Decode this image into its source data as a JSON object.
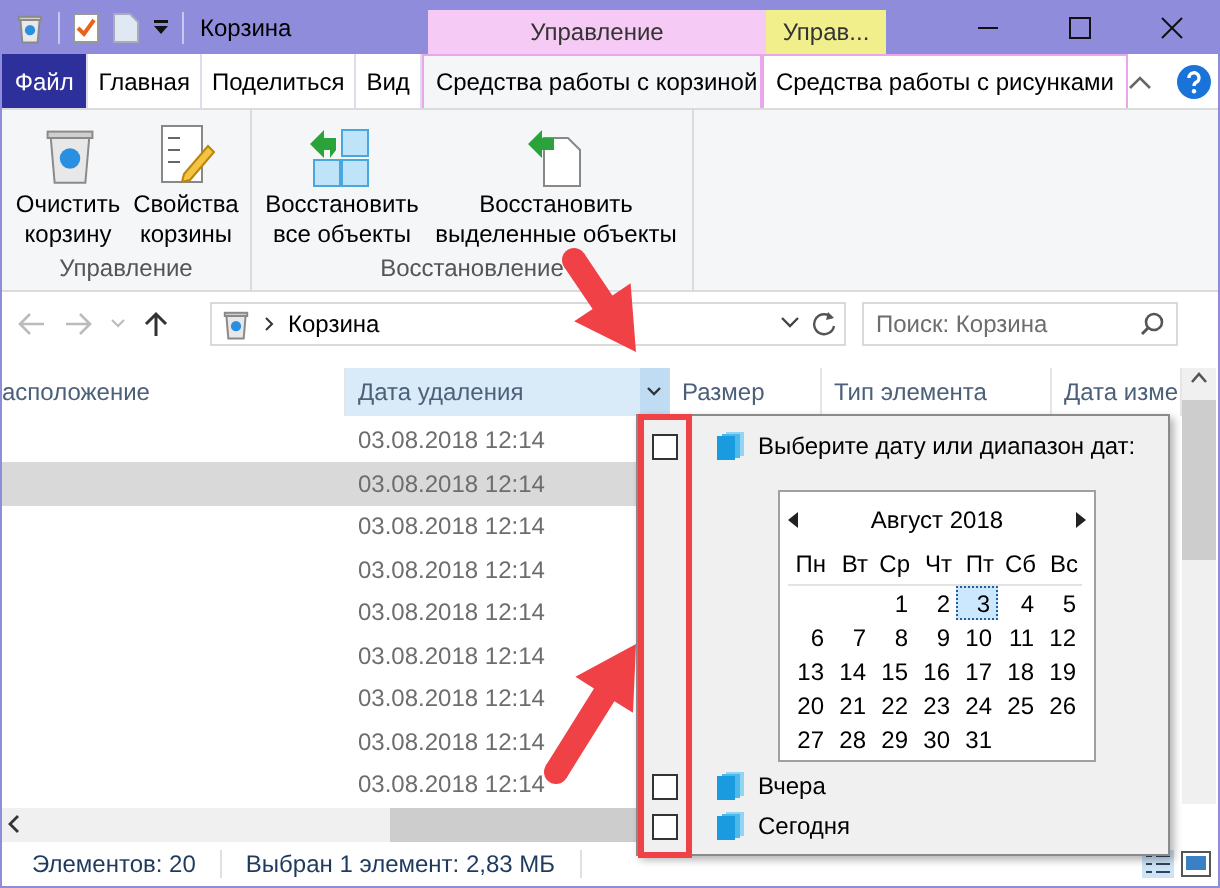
{
  "window": {
    "title": "Корзина",
    "context_tabs": [
      {
        "label": "Управление",
        "color": "#f5cbf5"
      },
      {
        "label": "Управ...",
        "color": "#f1ef8c"
      }
    ]
  },
  "ribbon_tabs": [
    {
      "label": "Файл",
      "kind": "file",
      "selected": false
    },
    {
      "label": "Главная",
      "kind": "tab",
      "selected": false
    },
    {
      "label": "Поделиться",
      "kind": "tab",
      "selected": false
    },
    {
      "label": "Вид",
      "kind": "tab",
      "selected": false
    },
    {
      "label": "Средства работы с корзиной",
      "kind": "context",
      "selected": true
    },
    {
      "label": "Средства работы с рисунками",
      "kind": "context",
      "selected": false
    }
  ],
  "ribbon_groups": [
    {
      "label": "Управление",
      "buttons": [
        {
          "label": "Очистить корзину",
          "kind": "empty"
        },
        {
          "label": "Свойства корзины",
          "kind": "properties"
        }
      ]
    },
    {
      "label": "Восстановление",
      "buttons": [
        {
          "label": "Восстановить все объекты",
          "kind": "restore_all"
        },
        {
          "label": "Восстановить выделенные объекты",
          "kind": "restore_selected"
        }
      ]
    }
  ],
  "address": {
    "path": "Корзина"
  },
  "search": {
    "placeholder": "Поиск: Корзина"
  },
  "columns": [
    {
      "label": "асположение",
      "active": false
    },
    {
      "label": "Дата удаления",
      "active": true
    },
    {
      "label": "Размер",
      "active": false
    },
    {
      "label": "Тип элемента",
      "active": false
    },
    {
      "label": "Дата изме",
      "active": false
    }
  ],
  "rows": [
    {
      "date_deleted": "03.08.2018 12:14",
      "selected": false
    },
    {
      "date_deleted": "03.08.2018 12:14",
      "selected": true
    },
    {
      "date_deleted": "03.08.2018 12:14",
      "selected": false
    },
    {
      "date_deleted": "03.08.2018 12:14",
      "selected": false
    },
    {
      "date_deleted": "03.08.2018 12:14",
      "selected": false
    },
    {
      "date_deleted": "03.08.2018 12:14",
      "selected": false
    },
    {
      "date_deleted": "03.08.2018 12:14",
      "selected": false
    },
    {
      "date_deleted": "03.08.2018 12:14",
      "selected": false
    },
    {
      "date_deleted": "03.08.2018 12:14",
      "selected": false
    }
  ],
  "filter_popup": {
    "items": [
      {
        "kind": "calendar",
        "label": "Выберите дату или диапазон дат:",
        "checked": false,
        "calendar": {
          "month": "Август 2018",
          "weekdays": [
            "Пн",
            "Вт",
            "Ср",
            "Чт",
            "Пт",
            "Сб",
            "Вс"
          ],
          "weeks": [
            [
              {
                "label": "1",
                "selected": false
              },
              {
                "label": "2",
                "selected": false
              },
              {
                "label": "3",
                "selected": true
              },
              {
                "label": "4",
                "selected": false
              },
              {
                "label": "5",
                "selected": false
              }
            ],
            [
              {
                "label": "6",
                "selected": false
              },
              {
                "label": "7",
                "selected": false
              },
              {
                "label": "8",
                "selected": false
              },
              {
                "label": "9",
                "selected": false
              },
              {
                "label": "10",
                "selected": false
              },
              {
                "label": "11",
                "selected": false
              },
              {
                "label": "12",
                "selected": false
              }
            ],
            [
              {
                "label": "13",
                "selected": false
              },
              {
                "label": "14",
                "selected": false
              },
              {
                "label": "15",
                "selected": false
              },
              {
                "label": "16",
                "selected": false
              },
              {
                "label": "17",
                "selected": false
              },
              {
                "label": "18",
                "selected": false
              },
              {
                "label": "19",
                "selected": false
              }
            ],
            [
              {
                "label": "20",
                "selected": false
              },
              {
                "label": "21",
                "selected": false
              },
              {
                "label": "22",
                "selected": false
              },
              {
                "label": "23",
                "selected": false
              },
              {
                "label": "24",
                "selected": false
              },
              {
                "label": "25",
                "selected": false
              },
              {
                "label": "26",
                "selected": false
              }
            ],
            [
              {
                "label": "27",
                "selected": false
              },
              {
                "label": "28",
                "selected": false
              },
              {
                "label": "29",
                "selected": false
              },
              {
                "label": "30",
                "selected": false
              },
              {
                "label": "31",
                "selected": false
              }
            ]
          ]
        }
      },
      {
        "kind": "option",
        "label": "Вчера",
        "checked": false
      },
      {
        "kind": "option",
        "label": "Сегодня",
        "checked": false
      }
    ]
  },
  "status_bar": [
    "Элементов: 20",
    "Выбран 1 элемент: 2,83 МБ"
  ]
}
